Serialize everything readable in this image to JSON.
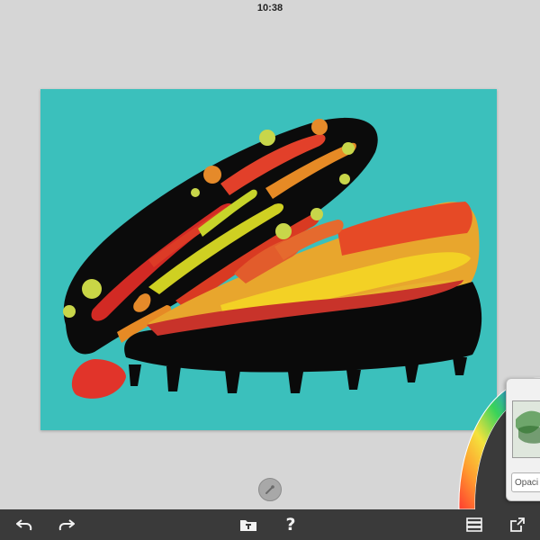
{
  "status_bar": {
    "time": "10:38"
  },
  "canvas": {
    "background_color": "#3bc0bc",
    "subject": "football-boot-painting"
  },
  "layers_panel": {
    "opacity_label": "Opaci"
  },
  "toolbar": {
    "undo_icon": "undo-arrow-icon",
    "redo_icon": "redo-arrow-icon",
    "gallery_icon": "gallery-folder-icon",
    "help_label": "?",
    "layers_icon": "layers-icon",
    "share_icon": "share-icon"
  },
  "colors": {
    "toolbar_bg": "#3a3a3a",
    "app_bg": "#d6d6d6",
    "canvas_bg": "#3bc0bc"
  }
}
